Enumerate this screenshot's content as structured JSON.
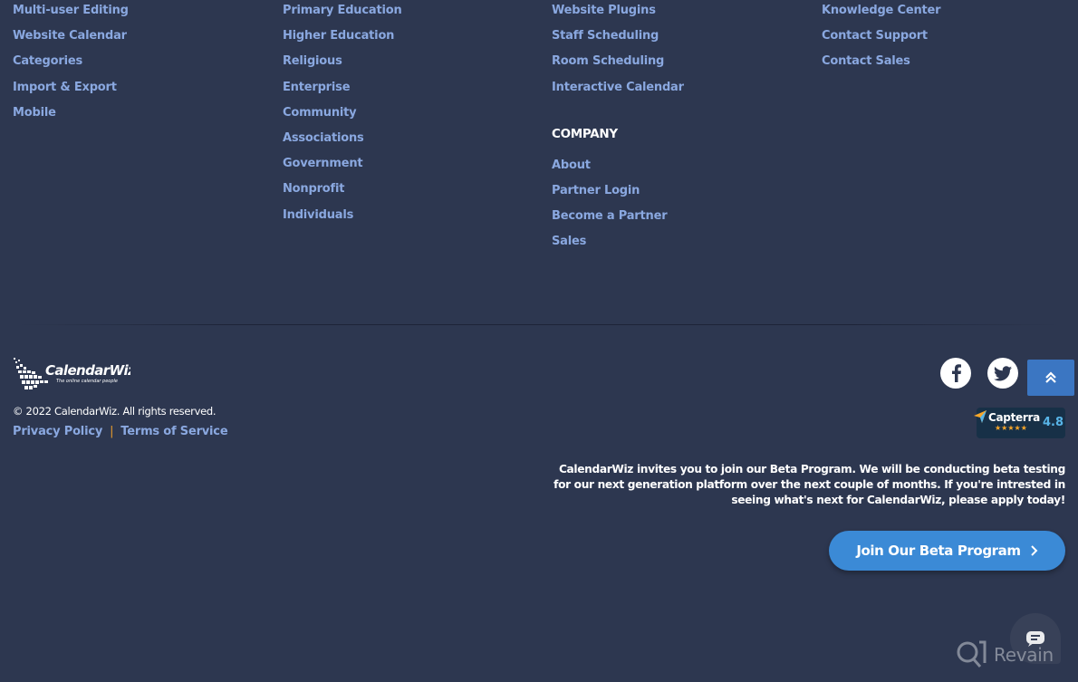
{
  "columns": [
    {
      "items": [
        "Multi-user Editing",
        "Website Calendar",
        "Categories",
        "Import & Export",
        "Mobile"
      ]
    },
    {
      "items": [
        "Primary Education",
        "Higher Education",
        "Religious",
        "Enterprise",
        "Community",
        "Associations",
        "Government",
        "Nonprofit",
        "Individuals"
      ]
    },
    {
      "items": [
        "Website Plugins",
        "Staff Scheduling",
        "Room Scheduling",
        "Interactive Calendar"
      ],
      "company_heading": "COMPANY",
      "company_items": [
        "About",
        "Partner Login",
        "Become a Partner",
        "Sales"
      ]
    },
    {
      "items": [
        "Knowledge Center",
        "Contact Support",
        "Contact Sales"
      ]
    }
  ],
  "logo": {
    "name": "CalendarWiz",
    "tagline": "The online calendar people"
  },
  "footer": {
    "copyright": "© 2022 CalendarWiz. All rights reserved.",
    "privacy": "Privacy Policy",
    "separator": "|",
    "terms": "Terms of Service"
  },
  "social": {
    "facebook": "facebook-icon",
    "twitter": "twitter-icon"
  },
  "capterra": {
    "name": "Capterra",
    "stars": "★★★★★",
    "score": "4.8"
  },
  "beta": {
    "text": "CalendarWiz invites you to join our Beta Program. We will be conducting beta testing for our next generation platform over the next couple of months. If you're intrested in seeing what's next for CalendarWiz, please apply today!",
    "button": "Join Our Beta Program"
  },
  "watermark": "Revain",
  "colors": {
    "background": "#2d3750",
    "link": "#8aa8e0",
    "accent": "#3b8ad6",
    "separator": "#e89b2c"
  }
}
